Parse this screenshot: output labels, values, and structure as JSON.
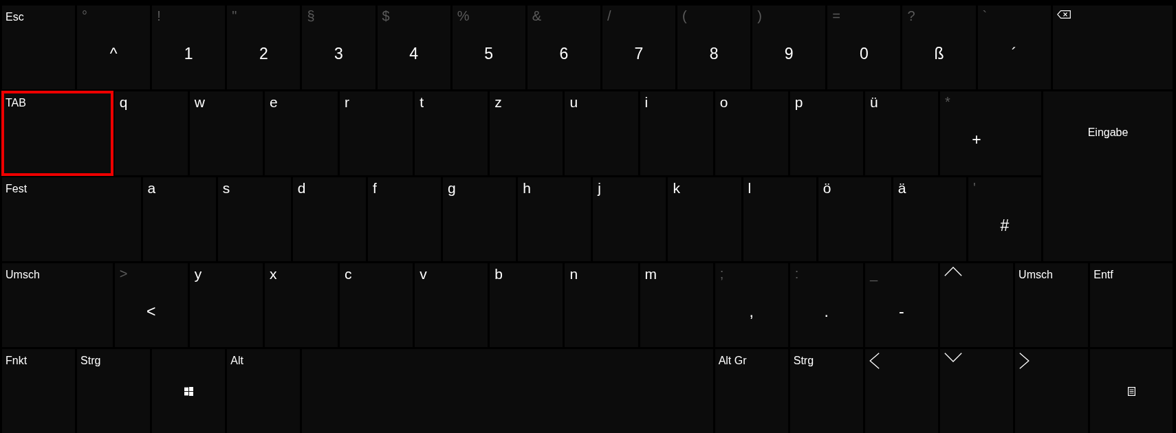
{
  "keyboard": {
    "rows": [
      {
        "keys": [
          {
            "kind": "modifier",
            "label": "Esc",
            "selected": false
          },
          {
            "kind": "dual",
            "shift": "°",
            "main": "^",
            "selected": false
          },
          {
            "kind": "dual",
            "shift": "!",
            "main": "1",
            "selected": false
          },
          {
            "kind": "dual",
            "shift": "\"",
            "main": "2",
            "selected": false
          },
          {
            "kind": "dual",
            "shift": "§",
            "main": "3",
            "selected": false
          },
          {
            "kind": "dual",
            "shift": "$",
            "main": "4",
            "selected": false
          },
          {
            "kind": "dual",
            "shift": "%",
            "main": "5",
            "selected": false
          },
          {
            "kind": "dual",
            "shift": "&",
            "main": "6",
            "selected": false
          },
          {
            "kind": "dual",
            "shift": "/",
            "main": "7",
            "selected": false
          },
          {
            "kind": "dual",
            "shift": "(",
            "main": "8",
            "selected": false
          },
          {
            "kind": "dual",
            "shift": ")",
            "main": "9",
            "selected": false
          },
          {
            "kind": "dual",
            "shift": "=",
            "main": "0",
            "selected": false
          },
          {
            "kind": "dual",
            "shift": "?",
            "main": "ß",
            "selected": false
          },
          {
            "kind": "dual",
            "shift": "`",
            "main": "´",
            "selected": false
          },
          {
            "kind": "backspace",
            "selected": false
          }
        ]
      },
      {
        "keys": [
          {
            "kind": "modifier",
            "label": "TAB",
            "selected": true
          },
          {
            "kind": "letter",
            "label": "q",
            "selected": false
          },
          {
            "kind": "letter",
            "label": "w",
            "selected": false
          },
          {
            "kind": "letter",
            "label": "e",
            "selected": false
          },
          {
            "kind": "letter",
            "label": "r",
            "selected": false
          },
          {
            "kind": "letter",
            "label": "t",
            "selected": false
          },
          {
            "kind": "letter",
            "label": "z",
            "selected": false
          },
          {
            "kind": "letter",
            "label": "u",
            "selected": false
          },
          {
            "kind": "letter",
            "label": "i",
            "selected": false
          },
          {
            "kind": "letter",
            "label": "o",
            "selected": false
          },
          {
            "kind": "letter",
            "label": "p",
            "selected": false
          },
          {
            "kind": "letter",
            "label": "ü",
            "selected": false
          },
          {
            "kind": "dual",
            "shift": "*",
            "main": "+",
            "selected": false
          },
          {
            "kind": "enter",
            "label": "Eingabe",
            "selected": false
          }
        ]
      },
      {
        "keys": [
          {
            "kind": "modifier",
            "label": "Fest",
            "selected": false
          },
          {
            "kind": "letter",
            "label": "a",
            "selected": false
          },
          {
            "kind": "letter",
            "label": "s",
            "selected": false
          },
          {
            "kind": "letter",
            "label": "d",
            "selected": false
          },
          {
            "kind": "letter",
            "label": "f",
            "selected": false
          },
          {
            "kind": "letter",
            "label": "g",
            "selected": false
          },
          {
            "kind": "letter",
            "label": "h",
            "selected": false
          },
          {
            "kind": "letter",
            "label": "j",
            "selected": false
          },
          {
            "kind": "letter",
            "label": "k",
            "selected": false
          },
          {
            "kind": "letter",
            "label": "l",
            "selected": false
          },
          {
            "kind": "letter",
            "label": "ö",
            "selected": false
          },
          {
            "kind": "letter",
            "label": "ä",
            "selected": false
          },
          {
            "kind": "dual",
            "shift": "'",
            "main": "#",
            "selected": false
          }
        ]
      },
      {
        "keys": [
          {
            "kind": "modifier",
            "label": "Umsch",
            "selected": false
          },
          {
            "kind": "dual",
            "shift": ">",
            "main": "<",
            "selected": false
          },
          {
            "kind": "letter",
            "label": "y",
            "selected": false
          },
          {
            "kind": "letter",
            "label": "x",
            "selected": false
          },
          {
            "kind": "letter",
            "label": "c",
            "selected": false
          },
          {
            "kind": "letter",
            "label": "v",
            "selected": false
          },
          {
            "kind": "letter",
            "label": "b",
            "selected": false
          },
          {
            "kind": "letter",
            "label": "n",
            "selected": false
          },
          {
            "kind": "letter",
            "label": "m",
            "selected": false
          },
          {
            "kind": "dual",
            "shift": ";",
            "main": ",",
            "selected": false
          },
          {
            "kind": "dual",
            "shift": ":",
            "main": ".",
            "selected": false
          },
          {
            "kind": "dual",
            "shift": "_",
            "main": "-",
            "selected": false
          },
          {
            "kind": "up",
            "selected": false
          },
          {
            "kind": "modifier",
            "label": "Umsch",
            "selected": false
          },
          {
            "kind": "modifier",
            "label": "Entf",
            "selected": false
          }
        ]
      },
      {
        "keys": [
          {
            "kind": "modifier",
            "label": "Fnkt",
            "selected": false
          },
          {
            "kind": "modifier",
            "label": "Strg",
            "selected": false
          },
          {
            "kind": "logo",
            "selected": false
          },
          {
            "kind": "modifier",
            "label": "Alt",
            "selected": false
          },
          {
            "kind": "space",
            "selected": false
          },
          {
            "kind": "modifier",
            "label": "Alt Gr",
            "selected": false
          },
          {
            "kind": "modifier",
            "label": "Strg",
            "selected": false
          },
          {
            "kind": "left",
            "selected": false
          },
          {
            "kind": "down",
            "selected": false
          },
          {
            "kind": "right",
            "selected": false
          },
          {
            "kind": "menu",
            "selected": false
          }
        ]
      }
    ]
  }
}
